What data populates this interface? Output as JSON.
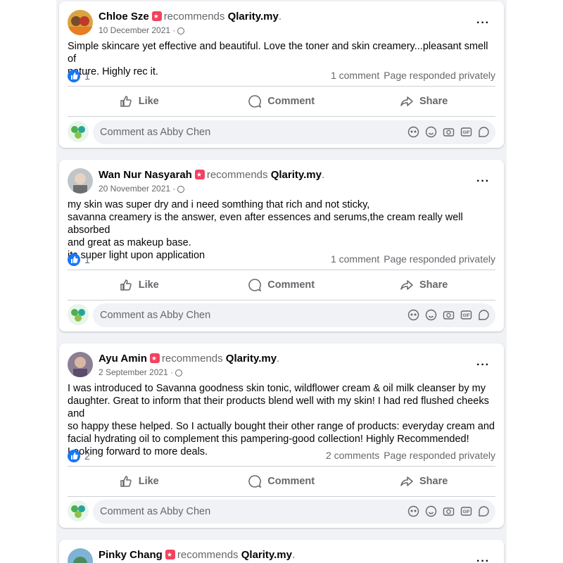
{
  "current_user": {
    "name": "Abby Chen",
    "comment_placeholder": "Comment as Abby Chen"
  },
  "page": {
    "name": "Qlarity.my",
    "recommends_text": "recommends"
  },
  "actions": {
    "like": "Like",
    "comment": "Comment",
    "share": "Share"
  },
  "posts": [
    {
      "author": "Chloe Sze",
      "date": "10 December 2021 ·",
      "body_lines": [
        "Simple skincare yet effective and beautiful. Love the toner and skin creamery...pleasant smell of",
        "nature. Highly rec it."
      ],
      "likes": "1",
      "comments": "1 comment",
      "responded": "Page responded privately"
    },
    {
      "author": "Wan Nur Nasyarah",
      "date": "20 November 2021 ·",
      "body_lines": [
        "my skin was super dry and i need somthing that rich and not sticky,",
        "savanna creamery is the answer, even after essences and serums,the cream really well absorbed",
        "and great as makeup base.",
        "its super light upon application"
      ],
      "likes": "1",
      "comments": "1 comment",
      "responded": "Page responded privately"
    },
    {
      "author": "Ayu Amin",
      "date": "2 September 2021 ·",
      "body_lines": [
        "I was introduced to Savanna goodness skin tonic, wildflower cream & oil milk cleanser by my",
        "daughter. Great to inform that their products blend well with my skin! I had red flushed cheeks and",
        "so happy these helped. So I actually bought their other range of products: everyday cream and",
        "facial hydrating oil to complement this pampering-good collection! Highly Recommended!",
        "Looking forward to more deals."
      ],
      "likes": "2",
      "comments": "2 comments",
      "responded": "Page responded privately"
    },
    {
      "author": "Pinky Chang"
    }
  ],
  "colors": {
    "accent": "#1877f2",
    "badge": "#f3425f",
    "muted": "#65676b",
    "feed_bg": "#f0f2f5"
  }
}
